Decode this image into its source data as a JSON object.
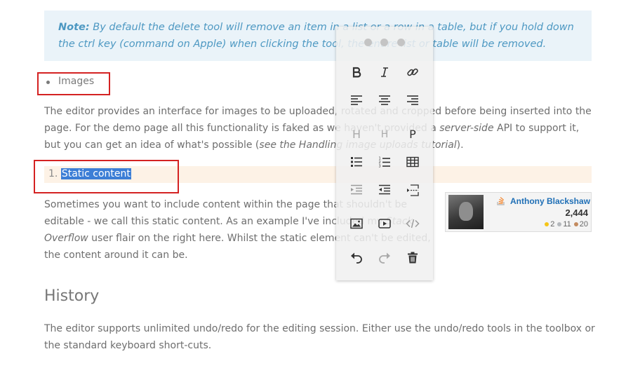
{
  "note": {
    "prefix": "Note:",
    "text": " By default the delete tool will remove an item in a list or a row in a table, but if you hold down the ctrl key (command on Apple) when clicking the tool, the entire list or table will be removed."
  },
  "images_item": {
    "label": "Images"
  },
  "images_paragraph": {
    "part1": "The editor provides an interface for images to be uploaded, rotated and cropped before being inserted into the page. For the demo page all this functionality is faked as we haven't provided a ",
    "emph1": "server-side",
    "part2": " API to support it, but you can get an idea of what's possible (",
    "emph2": "see the Handling image uploads tutorial",
    "part3": ")."
  },
  "static_item": {
    "number": "1.",
    "label": "Static content"
  },
  "static_paragraph": {
    "part1": "Sometimes you want to include content within the page that shouldn't be editable - we call this static content. As an example I've included my ",
    "emph": "Stack Overflow",
    "part2": " user flair on the right here. Whilst the static element can't be edited, the content around it can be."
  },
  "flair": {
    "name": "Anthony Blackshaw",
    "reputation": "2,444",
    "gold": "2",
    "silver": "11",
    "bronze": "20",
    "colors": {
      "gold": "#f5c518",
      "silver": "#b4b8bc",
      "bronze": "#c38b5f",
      "name": "#1f6fb6"
    }
  },
  "history": {
    "heading": "History",
    "paragraph": "The editor supports unlimited undo/redo for the editing session. Either use the undo/redo tools in the toolbox or the standard keyboard short-cuts."
  },
  "toolbox": {
    "heading1": "H",
    "subheading": "H",
    "paragraph": "P",
    "tools": [
      "bold-icon",
      "italic-icon",
      "link-icon",
      "align-left-icon",
      "align-center-icon",
      "align-right-icon",
      "heading-icon",
      "subheading-icon",
      "paragraph-icon",
      "bullet-list-icon",
      "numbered-list-icon",
      "table-icon",
      "indent-icon",
      "unindent-icon",
      "line-break-icon",
      "image-icon",
      "video-icon",
      "code-icon",
      "undo-icon",
      "redo-icon",
      "delete-icon"
    ]
  },
  "colors": {
    "accent": "#3c7ed6",
    "note_bg": "#eaf3f9",
    "note_text": "#4d98c2",
    "highlight_bg": "#fdf2e6",
    "annotation_box": "#d42222"
  }
}
